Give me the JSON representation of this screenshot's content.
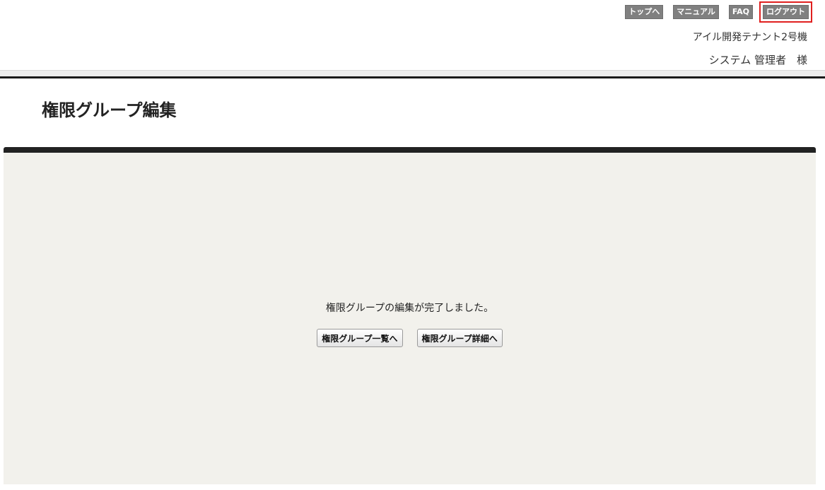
{
  "nav": {
    "top_label": "トップへ",
    "manual_label": "マニュアル",
    "faq_label": "FAQ",
    "logout_label": "ログアウト"
  },
  "header": {
    "tenant_name": "アイル開発テナント2号機",
    "user_name": "システム 管理者　様"
  },
  "page": {
    "title": "権限グループ編集"
  },
  "panel": {
    "message": "権限グループの編集が完了しました。",
    "list_button_label": "権限グループ一覧へ",
    "detail_button_label": "権限グループ詳細へ"
  },
  "colors": {
    "nav_bg": "#808080",
    "highlight": "#e0201f",
    "panel_bg": "#f2f1ec",
    "panel_border": "#222222"
  }
}
